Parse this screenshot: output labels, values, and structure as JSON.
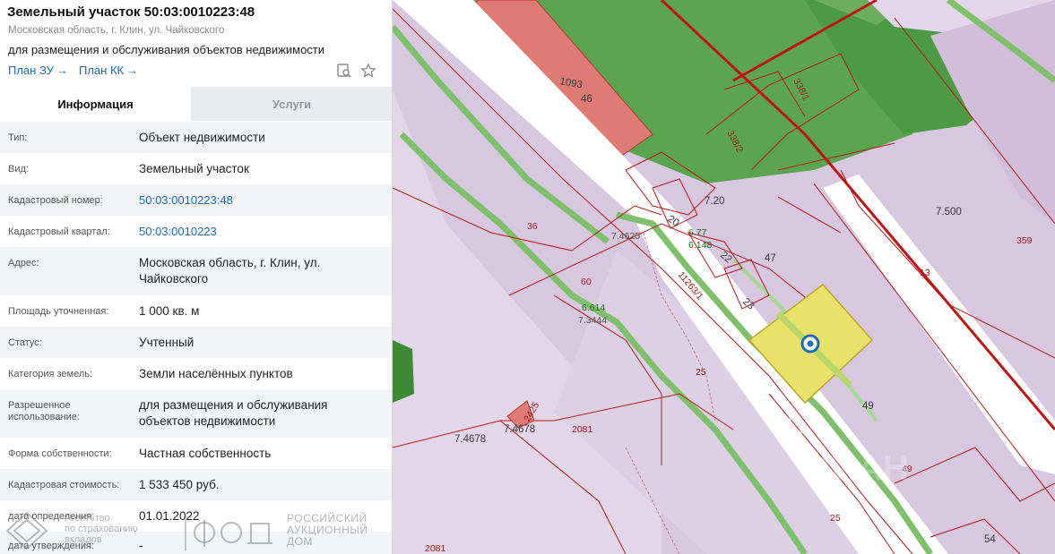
{
  "header": {
    "title": "Земельный участок 50:03:0010223:48",
    "address": "Московская область, г. Клин, ул. Чайковского",
    "purpose": "для размещения и обслуживания объектов недвижимости",
    "link_plan_zu": "План ЗУ",
    "link_plan_kk": "План КК",
    "icons": [
      "search-document-icon",
      "star-icon"
    ]
  },
  "tabs": {
    "info": "Информация",
    "services": "Услуги"
  },
  "rows": [
    {
      "label": "Тип:",
      "value": "Объект недвижимости"
    },
    {
      "label": "Вид:",
      "value": "Земельный участок"
    },
    {
      "label": "Кадастровый номер:",
      "value": "50:03:0010223:48"
    },
    {
      "label": "Кадастровый квартал:",
      "value": "50:03:0010223"
    },
    {
      "label": "Адрес:",
      "value": "Московская область, г. Клин, ул. Чайковского"
    },
    {
      "label": "Площадь уточненная:",
      "value": "1 000 кв. м"
    },
    {
      "label": "Статус:",
      "value": "Учтенный"
    },
    {
      "label": "Категория земель:",
      "value": "Земли населённых пунктов"
    },
    {
      "label": "Разрешенное использование:",
      "value": "для размещения и обслуживания объектов недвижимости"
    },
    {
      "label": "Форма собственности:",
      "value": "Частная собственность"
    },
    {
      "label": "Кадастровая стоимость:",
      "value": "1 533 450 руб."
    },
    {
      "label": "дата определения:",
      "value": "01.01.2022"
    },
    {
      "label": "дата утверждения:",
      "value": "-"
    }
  ],
  "watermark": {
    "line1": "Агентство",
    "line2": "по страхованию",
    "line3": "вкладов",
    "logo_text": "РАД",
    "line4": "РОССИЙСКИЙ",
    "line5": "АУКЦИОННЫЙ ДОМ"
  },
  "map": {
    "labels": {
      "l1093": "1093",
      "l46": "46",
      "l338_1": "338/1",
      "l338_2": "338/2",
      "l7_20": "7.20",
      "l20": "20",
      "l7_500": "7.500",
      "l359": "359",
      "l36": "36",
      "l7_4625": "7.4625",
      "l6_77": "6.77",
      "l6_148": "6.148",
      "l22": "22",
      "l47": "47",
      "l13": "13",
      "l60": "60",
      "l11263_1": "11263/1",
      "l23": "23",
      "l6_614": "6.614",
      "l7_3444": "7.3444",
      "l25a": "25",
      "l49a": "49",
      "l49b": "49",
      "l7_4678a": "7.4678",
      "l7_4678b": "7.4678",
      "l2425": "2425",
      "l2081a": "2081",
      "l2081b": "2081",
      "l25b": "25",
      "l54": "54",
      "watermark": "ЦИАН"
    }
  },
  "colors": {
    "accent_link": "#1f67b4",
    "map_green_dark": "#4a9a41",
    "map_green": "#7ab86a",
    "map_purple": "#d7c7df",
    "map_red_line": "#b81818",
    "selected_parcel": "#e8e26a",
    "marker": "#1f6fb2"
  }
}
